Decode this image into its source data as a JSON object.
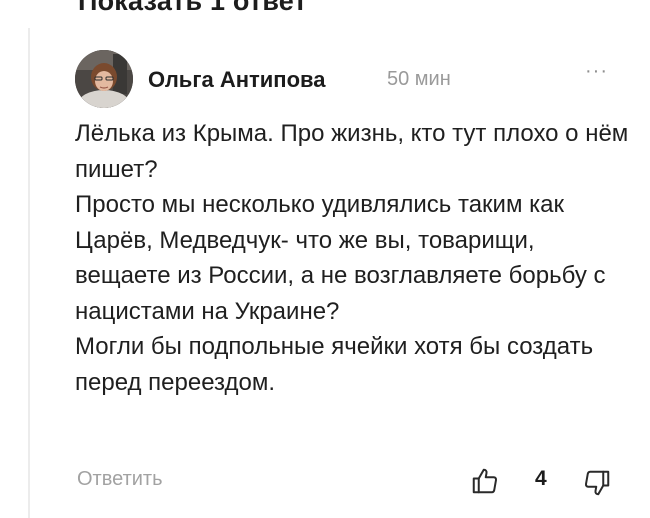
{
  "thread": {
    "show_replies_label": "Показать 1 ответ"
  },
  "comment": {
    "author": "Ольга Антипова",
    "time": "50 мин",
    "more_label": "···",
    "paragraphs": [
      "Лёлька из Крыма. Про жизнь, кто тут плохо о нём пишет?",
      "Просто мы несколько удивлялись таким как Царёв, Медведчук- что же вы, товарищи, вещаете из России, а не возглавляете борьбу с нацистами на Украине?",
      "Могли бы подпольные ячейки хотя бы создать перед переездом."
    ],
    "reply_label": "Ответить",
    "like_count": "4"
  },
  "icons": {
    "avatar": "user-photo",
    "more": "more-dots-icon",
    "like": "thumbs-up-icon",
    "dislike": "thumbs-down-icon"
  },
  "colors": {
    "text": "#1f1f1f",
    "muted": "#9a9a9a",
    "thread_line": "#ececec"
  }
}
